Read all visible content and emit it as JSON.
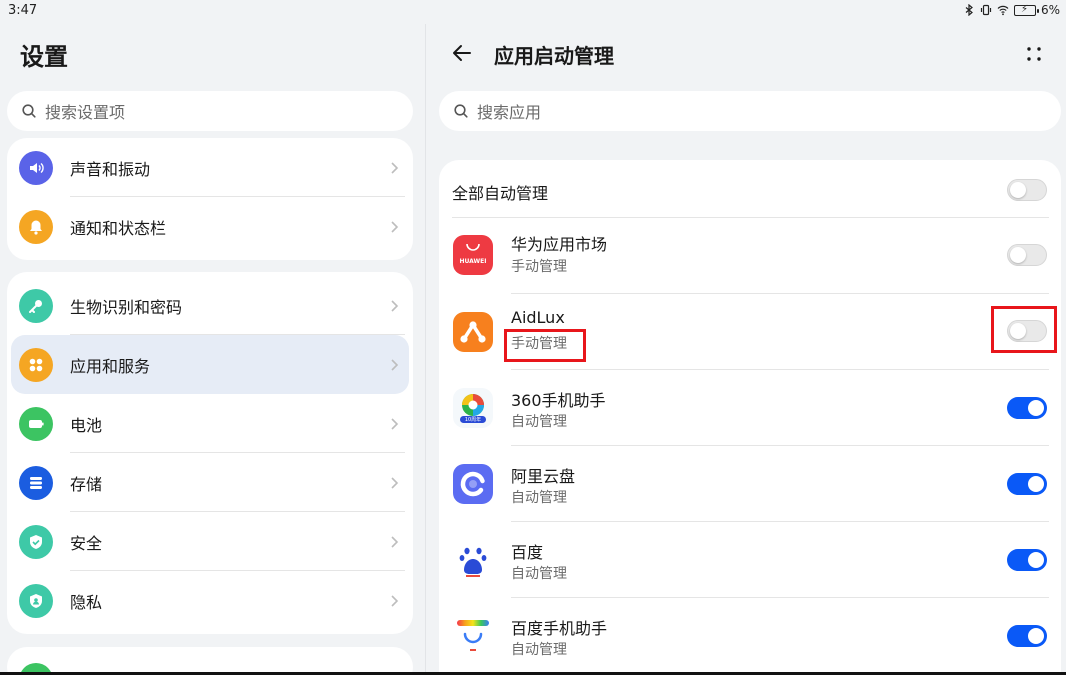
{
  "status": {
    "time": "3:47",
    "battery": "6%"
  },
  "left": {
    "title": "设置",
    "search_placeholder": "搜索设置项",
    "group1": [
      {
        "label": "声音和振动",
        "color": "#5a63e8"
      },
      {
        "label": "通知和状态栏",
        "color": "#f5a623"
      }
    ],
    "group2": [
      {
        "label": "生物识别和密码",
        "color": "#3ec9a7"
      },
      {
        "label": "应用和服务",
        "color": "#f5a623"
      },
      {
        "label": "电池",
        "color": "#3cc462"
      },
      {
        "label": "存储",
        "color": "#1b5de0"
      },
      {
        "label": "安全",
        "color": "#3ec9a7"
      },
      {
        "label": "隐私",
        "color": "#3ec9a7"
      }
    ]
  },
  "right": {
    "title": "应用启动管理",
    "search_placeholder": "搜索应用",
    "all_label": "全部自动管理",
    "apps": [
      {
        "name": "华为应用市场",
        "status": "手动管理",
        "on": false
      },
      {
        "name": "AidLux",
        "status": "手动管理",
        "on": false
      },
      {
        "name": "360手机助手",
        "status": "自动管理",
        "on": true
      },
      {
        "name": "阿里云盘",
        "status": "自动管理",
        "on": true
      },
      {
        "name": "百度",
        "status": "自动管理",
        "on": true
      },
      {
        "name": "百度手机助手",
        "status": "自动管理",
        "on": true
      }
    ],
    "huawei_logo_text": "HUAWEI",
    "anniv_text": "10周年"
  },
  "colors": {
    "accent": "#0a59f7",
    "highlight": "#e8161b"
  }
}
